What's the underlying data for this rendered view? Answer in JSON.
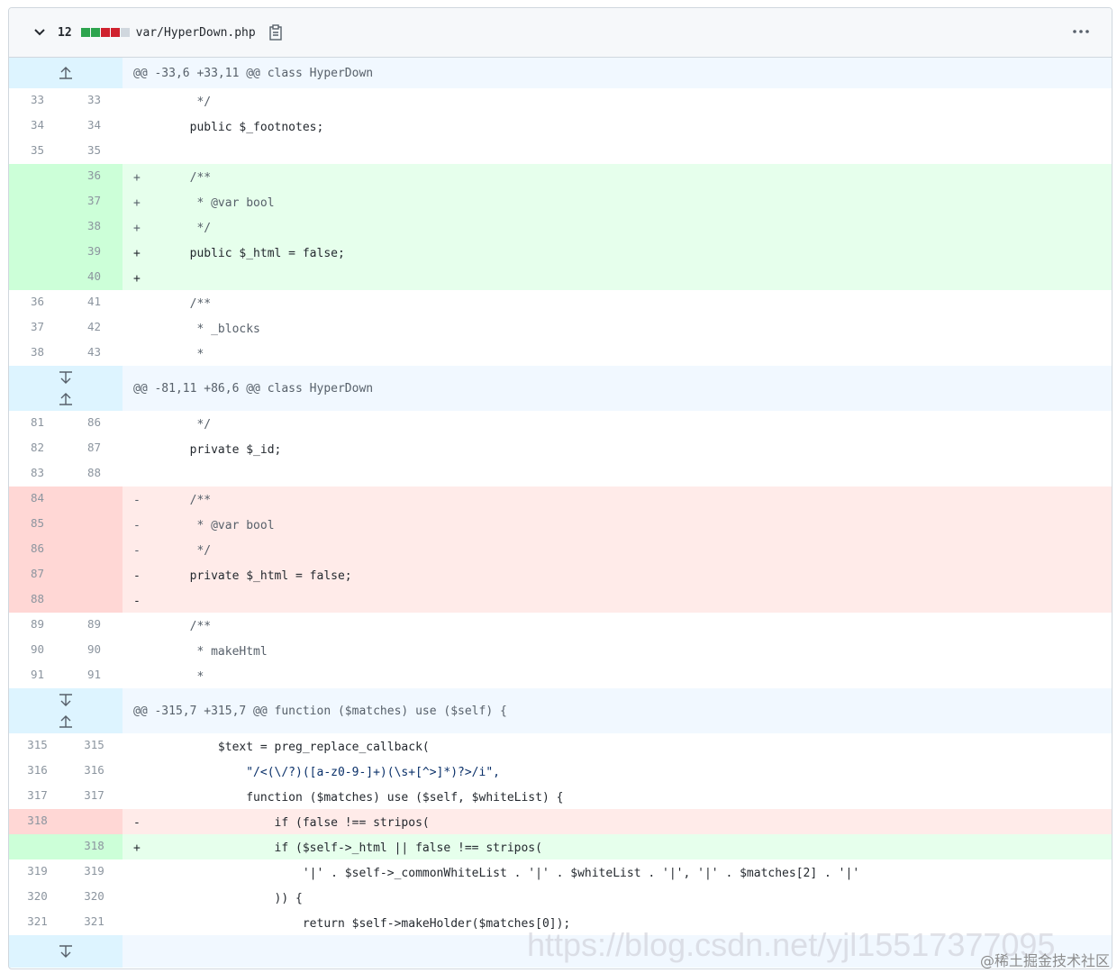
{
  "file": {
    "changes_count": "12",
    "filename": "var/HyperDown.php",
    "diffstat": [
      "add",
      "add",
      "del",
      "del",
      "neu"
    ]
  },
  "colors": {
    "add": "#2da44e",
    "del": "#cf222e",
    "hunk_bg": "#ddf4ff"
  },
  "hunks": [
    {
      "header": "@@ -33,6 +33,11 @@ class HyperDown"
    },
    {
      "header": "@@ -81,11 +86,6 @@ class HyperDown"
    },
    {
      "header": "@@ -315,7 +315,7 @@ function ($matches) use ($self) {"
    }
  ],
  "lines": [
    {
      "old": "33",
      "new": "33",
      "text": "         */"
    },
    {
      "old": "34",
      "new": "34",
      "text": "        public $_footnotes;"
    },
    {
      "old": "35",
      "new": "35",
      "text": ""
    },
    {
      "old": "",
      "new": "36",
      "text": "+       /**"
    },
    {
      "old": "",
      "new": "37",
      "text": "+        * @var bool"
    },
    {
      "old": "",
      "new": "38",
      "text": "+        */"
    },
    {
      "old": "",
      "new": "39",
      "text": "+       public $_html = false;"
    },
    {
      "old": "",
      "new": "40",
      "text": "+"
    },
    {
      "old": "36",
      "new": "41",
      "text": "        /**"
    },
    {
      "old": "37",
      "new": "42",
      "text": "         * _blocks"
    },
    {
      "old": "38",
      "new": "43",
      "text": "         *"
    },
    {
      "old": "81",
      "new": "86",
      "text": "         */"
    },
    {
      "old": "82",
      "new": "87",
      "text": "        private $_id;"
    },
    {
      "old": "83",
      "new": "88",
      "text": ""
    },
    {
      "old": "84",
      "new": "",
      "text": "-       /**"
    },
    {
      "old": "85",
      "new": "",
      "text": "-        * @var bool"
    },
    {
      "old": "86",
      "new": "",
      "text": "-        */"
    },
    {
      "old": "87",
      "new": "",
      "text": "-       private $_html = false;"
    },
    {
      "old": "88",
      "new": "",
      "text": "-"
    },
    {
      "old": "89",
      "new": "89",
      "text": "        /**"
    },
    {
      "old": "90",
      "new": "90",
      "text": "         * makeHtml"
    },
    {
      "old": "91",
      "new": "91",
      "text": "         *"
    },
    {
      "old": "315",
      "new": "315",
      "text": "            $text = preg_replace_callback("
    },
    {
      "old": "316",
      "new": "316",
      "text": "                \"/<(\\/?)([a-z0-9-]+)(\\s+[^>]*)?>/i\","
    },
    {
      "old": "317",
      "new": "317",
      "text": "                function ($matches) use ($self, $whiteList) {"
    },
    {
      "old": "318",
      "new": "",
      "text": "-                   if (false !== stripos("
    },
    {
      "old": "",
      "new": "318",
      "text": "+                   if ($self->_html || false !== stripos("
    },
    {
      "old": "319",
      "new": "319",
      "text": "                        '|' . $self->_commonWhiteList . '|' . $whiteList . '|', '|' . $matches[2] . '|'"
    },
    {
      "old": "320",
      "new": "320",
      "text": "                    )) {"
    },
    {
      "old": "321",
      "new": "321",
      "text": "                        return $self->makeHolder($matches[0]);"
    }
  ],
  "watermark": {
    "url": "https://blog.csdn.net/yjl15517377095",
    "site": "@稀土掘金技术社区"
  }
}
